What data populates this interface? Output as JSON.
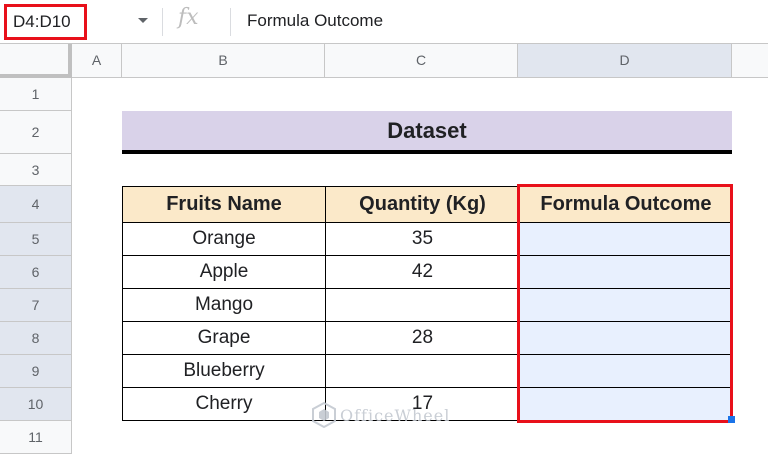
{
  "formula_bar": {
    "name_box": "D4:D10",
    "fx_symbol": "fx",
    "formula": "Formula Outcome"
  },
  "columns": [
    "A",
    "B",
    "C",
    "D"
  ],
  "rows": [
    "1",
    "2",
    "3",
    "4",
    "5",
    "6",
    "7",
    "8",
    "9",
    "10",
    "11"
  ],
  "dataset_title": "Dataset",
  "table": {
    "headers": [
      "Fruits Name",
      "Quantity (Kg)",
      "Formula Outcome"
    ],
    "rows": [
      {
        "fruit": "Orange",
        "qty": "35",
        "outcome": ""
      },
      {
        "fruit": "Apple",
        "qty": "42",
        "outcome": ""
      },
      {
        "fruit": "Mango",
        "qty": "",
        "outcome": ""
      },
      {
        "fruit": "Grape",
        "qty": "28",
        "outcome": ""
      },
      {
        "fruit": "Blueberry",
        "qty": "",
        "outcome": ""
      },
      {
        "fruit": "Cherry",
        "qty": "17",
        "outcome": ""
      }
    ]
  },
  "watermark": "OfficeWheel",
  "colors": {
    "selection_border": "#e8101a",
    "header_fill": "#fbe9c9",
    "title_fill": "#d9d2e9",
    "selected_fill": "#e8f0fe"
  }
}
